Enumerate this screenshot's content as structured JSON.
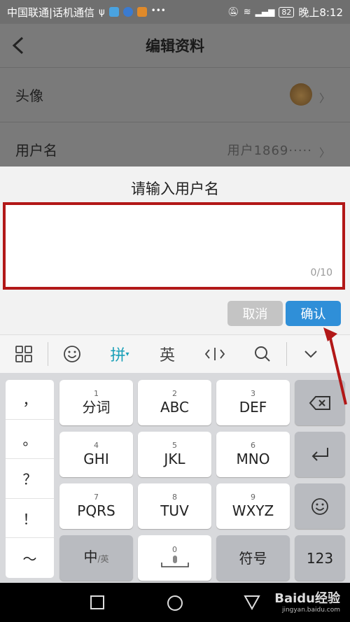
{
  "status_bar": {
    "carrier": "中国联通|话机通信",
    "battery": "82",
    "time": "晚上8:12",
    "icons": [
      "usb-icon",
      "shield-app-icon",
      "browser-app-icon",
      "video-app-icon",
      "chat-icon",
      "mute-icon",
      "wifi-icon",
      "signal-icon",
      "battery-icon"
    ]
  },
  "header": {
    "title": "编辑资料",
    "back_icon": "chevron-left-icon"
  },
  "rows": [
    {
      "label": "头像"
    },
    {
      "label": "用户名",
      "value": "用户1869·····"
    }
  ],
  "dialog": {
    "title": "请输入用户名",
    "input_value": "",
    "counter": "0/10",
    "cancel_label": "取消",
    "confirm_label": "确认",
    "highlight_color": "#b21818",
    "confirm_color": "#2f8fd8"
  },
  "keyboard_toolbar": {
    "items": [
      "grid-icon",
      "emoji-icon",
      "拼",
      "英",
      "cursor-icon",
      "search-icon",
      "collapse-icon"
    ],
    "pinyin_label": "拼",
    "english_label": "英",
    "active_color": "#1aa0b8"
  },
  "keyboard": {
    "punctuation": [
      "，",
      "。",
      "？",
      "！",
      "～"
    ],
    "keys": [
      {
        "num": "1",
        "label": "分词"
      },
      {
        "num": "2",
        "label": "ABC"
      },
      {
        "num": "3",
        "label": "DEF"
      },
      {
        "num": "4",
        "label": "GHI"
      },
      {
        "num": "5",
        "label": "JKL"
      },
      {
        "num": "6",
        "label": "MNO"
      },
      {
        "num": "7",
        "label": "PQRS"
      },
      {
        "num": "8",
        "label": "TUV"
      },
      {
        "num": "9",
        "label": "WXYZ"
      }
    ],
    "bottom": {
      "lang_main": "中",
      "lang_sub": "/英",
      "space_num": "0",
      "symbols": "符号",
      "numbers": "123"
    }
  },
  "navbar": {
    "icons": [
      "square-icon",
      "circle-icon",
      "triangle-back-icon"
    ],
    "watermark": "Baidu经验",
    "watermark_sub": "jingyan.baidu.com"
  }
}
